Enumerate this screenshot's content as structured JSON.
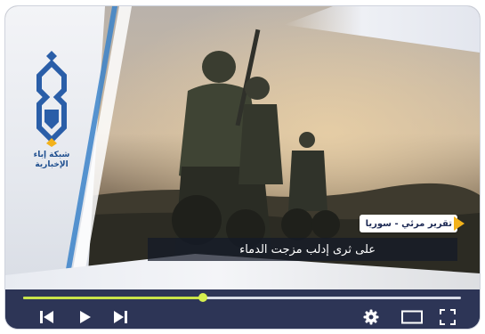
{
  "logo": {
    "text_line1": "شبكة إباء",
    "text_line2": "الإخبارية",
    "colors": {
      "primary": "#2a5ea8",
      "accent": "#f3b21b"
    }
  },
  "overlay": {
    "tag": "تقرير مرئي - سوريا",
    "headline": "على ثرى إدلب مزجت الدماء"
  },
  "player": {
    "progress_fraction": 0.41,
    "controls": {
      "previous": "skip-previous-icon",
      "play": "play-icon",
      "next": "skip-next-icon",
      "settings": "gear-icon",
      "theater": "theater-mode-icon",
      "fullscreen": "fullscreen-icon"
    },
    "colors": {
      "bar": "#2d3556",
      "progress": "#c9e44a",
      "icons": "#ffffff"
    }
  }
}
